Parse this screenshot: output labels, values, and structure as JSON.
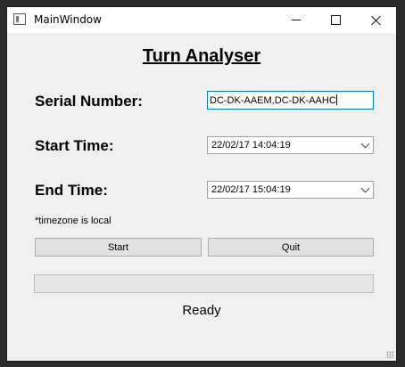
{
  "window": {
    "title": "MainWindow",
    "icons": {
      "app": "app-icon",
      "minimize": "minimize-icon",
      "maximize": "maximize-icon",
      "close": "close-icon"
    }
  },
  "main": {
    "heading": "Turn Analyser",
    "serial_label": "Serial Number:",
    "serial_value": "DC-DK-AAEM,DC-DK-AAHC",
    "start_label": "Start Time:",
    "start_value": "22/02/17 14:04:19",
    "end_label": "End Time:",
    "end_value": "22/02/17 15:04:19",
    "note": "*timezone is local",
    "start_button": "Start",
    "quit_button": "Quit",
    "progress": 0,
    "status": "Ready"
  }
}
